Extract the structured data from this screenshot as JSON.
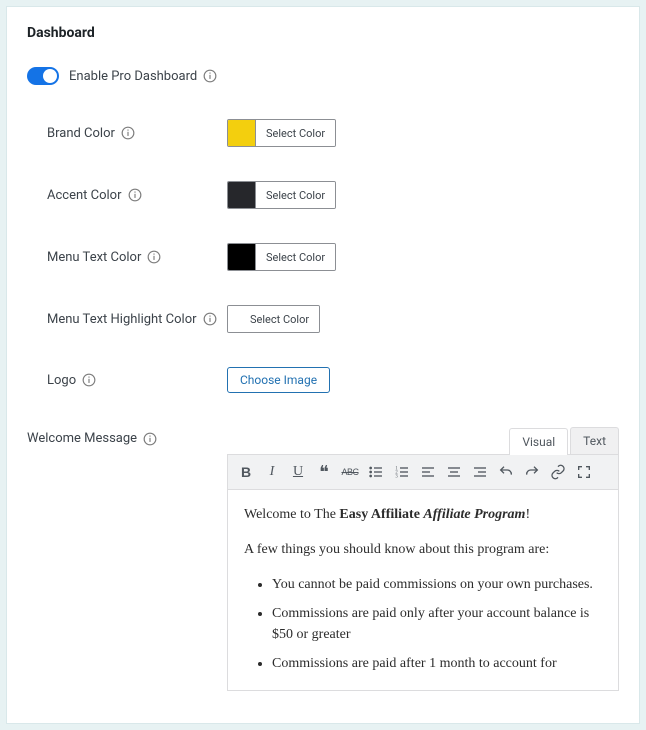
{
  "panel": {
    "title": "Dashboard"
  },
  "settings": {
    "enable": {
      "label": "Enable Pro Dashboard"
    },
    "brand": {
      "label": "Brand Color",
      "btn": "Select Color",
      "swatch": "#f3cf0e"
    },
    "accent": {
      "label": "Accent Color",
      "btn": "Select Color",
      "swatch": "#26272b"
    },
    "menu": {
      "label": "Menu Text Color",
      "btn": "Select Color",
      "swatch": "#000000"
    },
    "hl": {
      "label": "Menu Text Highlight Color",
      "btn": "Select Color",
      "swatch": "#ffffff"
    },
    "logo": {
      "label": "Logo",
      "btn": "Choose Image"
    },
    "welcome": {
      "label": "Welcome Message"
    }
  },
  "editor": {
    "tabs": {
      "visual": "Visual",
      "text": "Text"
    },
    "content": {
      "line1_pre": "Welcome to The ",
      "line1_bold": "Easy Affiliate",
      "line1_space": " ",
      "line1_ital": "Affiliate Program",
      "line1_bang": "!",
      "line2": "A few things you should know about this program are:",
      "bullets": [
        "You cannot be paid commissions on your own purchases.",
        "Commissions are paid only after your account balance is $50 or greater",
        "Commissions are paid after 1 month to account for"
      ]
    }
  }
}
